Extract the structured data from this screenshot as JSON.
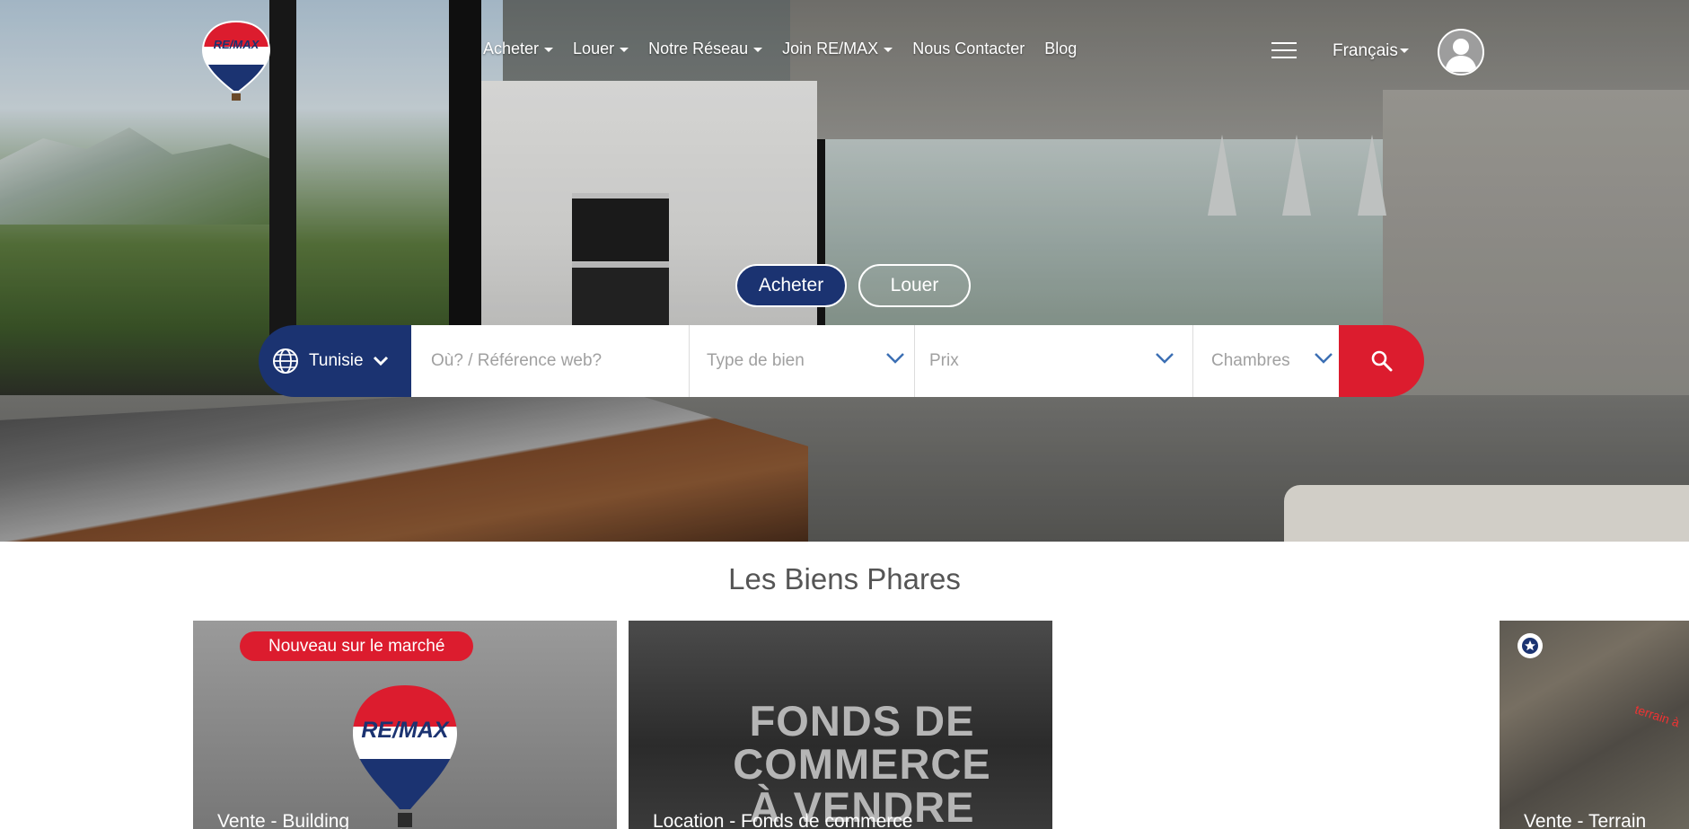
{
  "brand": {
    "logo_text": "RE/MAX",
    "primary_color": "#1b3371",
    "accent_color": "#dc1c2e"
  },
  "nav": {
    "items": [
      {
        "label": "Acheter",
        "has_dropdown": true
      },
      {
        "label": "Louer",
        "has_dropdown": true
      },
      {
        "label": "Notre Réseau",
        "has_dropdown": true
      },
      {
        "label": "Join RE/MAX",
        "has_dropdown": true
      },
      {
        "label": "Nous Contacter",
        "has_dropdown": false
      },
      {
        "label": "Blog",
        "has_dropdown": false
      }
    ],
    "menu_icon": "hamburger-icon",
    "language": "Français",
    "user_icon": "user-avatar-icon"
  },
  "search": {
    "mode_buy": "Acheter",
    "mode_rent": "Louer",
    "active_mode": "Acheter",
    "country": "Tunisie",
    "location_placeholder": "Où? / Référence web?",
    "property_type_placeholder": "Type de bien",
    "price_placeholder": "Prix",
    "bedrooms_placeholder": "Chambres",
    "search_icon": "search-icon"
  },
  "featured": {
    "title": "Les Biens Phares",
    "cards": [
      {
        "caption": "Vente - Building",
        "badge": "Nouveau sur le marché",
        "image_logo": "RE/MAX"
      },
      {
        "caption": "Location - Fonds de commerce",
        "image_text": "FONDS DE COMMERCE À VENDRE"
      },
      {
        "caption": "Vente - Terrain",
        "image_text": "terrain à"
      }
    ]
  }
}
